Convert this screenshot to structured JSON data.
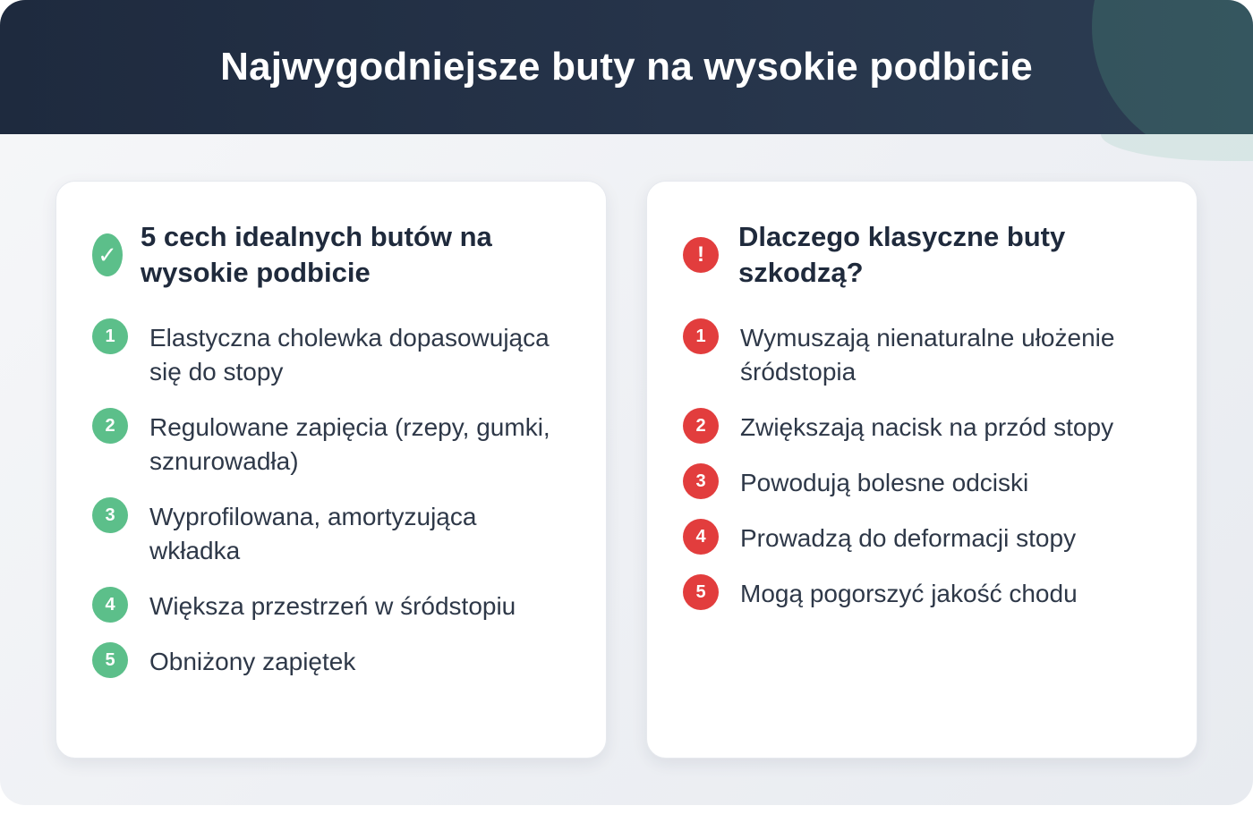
{
  "header": {
    "title": "Najwygodniejsze buty na wysokie podbicie"
  },
  "colors": {
    "header_bg": "#1e2a3e",
    "green": "#5cbf8a",
    "red": "#e23d3d"
  },
  "left_card": {
    "icon": "check-icon",
    "icon_glyph": "✓",
    "title": "5 cech idealnych butów na wysokie podbicie",
    "items": [
      {
        "num": "1",
        "text": "Elastyczna cholewka dopasowująca się do stopy"
      },
      {
        "num": "2",
        "text": "Regulowane zapięcia (rzepy, gumki, sznurowadła)"
      },
      {
        "num": "3",
        "text": "Wyprofilowana, amortyzująca wkładka"
      },
      {
        "num": "4",
        "text": "Większa przestrzeń w śródstopiu"
      },
      {
        "num": "5",
        "text": "Obniżony zapiętek"
      }
    ]
  },
  "right_card": {
    "icon": "exclamation-icon",
    "icon_glyph": "!",
    "title": "Dlaczego klasyczne buty szkodzą?",
    "items": [
      {
        "num": "1",
        "text": "Wymuszają nienaturalne ułożenie śródstopia"
      },
      {
        "num": "2",
        "text": "Zwiększają nacisk na przód stopy"
      },
      {
        "num": "3",
        "text": "Powodują bolesne odciski"
      },
      {
        "num": "4",
        "text": "Prowadzą do deformacji stopy"
      },
      {
        "num": "5",
        "text": "Mogą pogorszyć jakość chodu"
      }
    ]
  }
}
